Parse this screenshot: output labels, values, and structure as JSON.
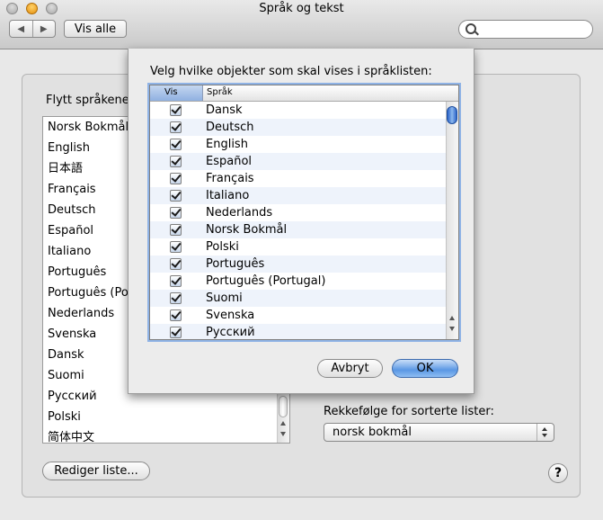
{
  "window": {
    "title": "Språk og tekst"
  },
  "toolbar": {
    "back_icon": "◀",
    "forward_icon": "▶",
    "show_all_label": "Vis alle",
    "search_value": ""
  },
  "main": {
    "reorder_label": "Flytt språkene",
    "languages": [
      "Norsk Bokmål",
      "English",
      "日本語",
      "Français",
      "Deutsch",
      "Español",
      "Italiano",
      "Português",
      "Português (Por",
      "Nederlands",
      "Svenska",
      "Dansk",
      "Suomi",
      "Русский",
      "Polski",
      "简体中文"
    ],
    "edit_list_label": "Rediger liste...",
    "sort_order_label": "Rekkefølge for sorterte lister:",
    "sort_order_value": "norsk bokmål",
    "help_label": "?"
  },
  "sheet": {
    "title": "Velg hvilke objekter som skal vises i språklisten:",
    "col_show": "Vis",
    "col_language": "Språk",
    "rows": [
      {
        "name": "Dansk",
        "checked": true
      },
      {
        "name": "Deutsch",
        "checked": true
      },
      {
        "name": "English",
        "checked": true
      },
      {
        "name": "Español",
        "checked": true
      },
      {
        "name": "Français",
        "checked": true
      },
      {
        "name": "Italiano",
        "checked": true
      },
      {
        "name": "Nederlands",
        "checked": true
      },
      {
        "name": "Norsk Bokmål",
        "checked": true
      },
      {
        "name": "Polski",
        "checked": true
      },
      {
        "name": "Português",
        "checked": true
      },
      {
        "name": "Português (Portugal)",
        "checked": true
      },
      {
        "name": "Suomi",
        "checked": true
      },
      {
        "name": "Svenska",
        "checked": true
      },
      {
        "name": "Русский",
        "checked": true
      }
    ],
    "cancel_label": "Avbryt",
    "ok_label": "OK"
  },
  "colors": {
    "accent": "#5a97e4",
    "header_selected": "#8fb0e1"
  }
}
